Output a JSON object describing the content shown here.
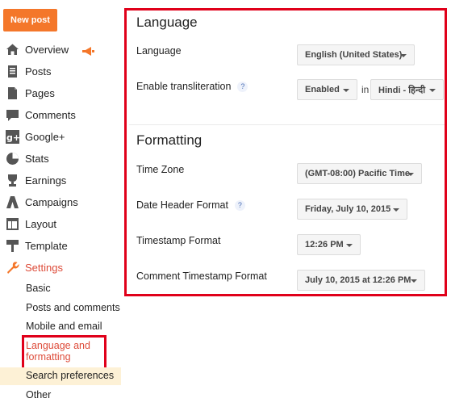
{
  "sidebar": {
    "new_post": "New post",
    "items": [
      {
        "label": "Overview",
        "icon": "home-icon"
      },
      {
        "label": "Posts",
        "icon": "posts-icon"
      },
      {
        "label": "Pages",
        "icon": "pages-icon"
      },
      {
        "label": "Comments",
        "icon": "comments-icon"
      },
      {
        "label": "Google+",
        "icon": "google-plus-icon"
      },
      {
        "label": "Stats",
        "icon": "stats-icon"
      },
      {
        "label": "Earnings",
        "icon": "earnings-icon"
      },
      {
        "label": "Campaigns",
        "icon": "campaigns-icon"
      },
      {
        "label": "Layout",
        "icon": "layout-icon"
      },
      {
        "label": "Template",
        "icon": "template-icon"
      },
      {
        "label": "Settings",
        "icon": "settings-icon"
      }
    ],
    "settings_sub": [
      "Basic",
      "Posts and comments",
      "Mobile and email",
      "Language and",
      "formatting",
      "Search preferences",
      "Other"
    ]
  },
  "language": {
    "title": "Language",
    "language_label": "Language",
    "language_value": "English (United States)",
    "translit_label": "Enable transliteration",
    "help": "?",
    "translit_value": "Enabled",
    "in": "in",
    "translit_lang": "Hindi - हिन्दी"
  },
  "formatting": {
    "title": "Formatting",
    "timezone_label": "Time Zone",
    "timezone_value": "(GMT-08:00) Pacific Time",
    "date_header_label": "Date Header Format",
    "help": "?",
    "date_header_value": "Friday, July 10, 2015",
    "timestamp_label": "Timestamp Format",
    "timestamp_value": "12:26 PM",
    "comment_ts_label": "Comment Timestamp Format",
    "comment_ts_value": "July 10, 2015 at 12:26 PM"
  },
  "colors": {
    "accent": "#f4772a",
    "highlight_border": "#e0001a",
    "active_text": "#dd4b39"
  }
}
